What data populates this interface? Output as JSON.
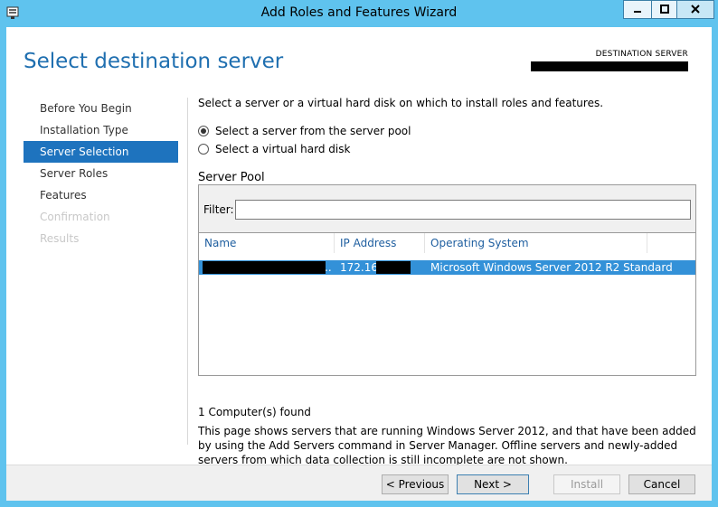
{
  "window": {
    "title": "Add Roles and Features Wizard",
    "minimize_glyph": "—",
    "maximize_glyph": "☐",
    "close_glyph": "✕",
    "icon": "server-manager-icon"
  },
  "page": {
    "heading": "Select destination server",
    "destination_label": "DESTINATION SERVER"
  },
  "nav": {
    "items": [
      {
        "label": "Before You Begin",
        "state": "normal"
      },
      {
        "label": "Installation Type",
        "state": "normal"
      },
      {
        "label": "Server Selection",
        "state": "active"
      },
      {
        "label": "Server Roles",
        "state": "normal"
      },
      {
        "label": "Features",
        "state": "normal"
      },
      {
        "label": "Confirmation",
        "state": "disabled"
      },
      {
        "label": "Results",
        "state": "disabled"
      }
    ]
  },
  "main": {
    "intro": "Select a server or a virtual hard disk on which to install roles and features.",
    "radio_pool": "Select a server from the server pool",
    "radio_vhd": "Select a virtual hard disk",
    "pool_label": "Server Pool",
    "filter_label": "Filter:",
    "filter_value": "",
    "columns": [
      "Name",
      "IP Address",
      "Operating System"
    ],
    "rows": [
      {
        "name": "..",
        "ip": "172.16.",
        "os": "Microsoft Windows Server 2012 R2 Standard"
      }
    ],
    "found": "1 Computer(s) found",
    "note": "This page shows servers that are running Windows Server 2012, and that have been added by using the Add Servers command in Server Manager. Offline servers and newly-added servers from which data collection is still incomplete are not shown."
  },
  "footer": {
    "previous": "< Previous",
    "next": "Next >",
    "install": "Install",
    "cancel": "Cancel"
  },
  "colors": {
    "accent": "#1e73be",
    "heading": "#1f6fb0",
    "selected_row": "#3391d8",
    "frame": "#5fc3ee"
  }
}
